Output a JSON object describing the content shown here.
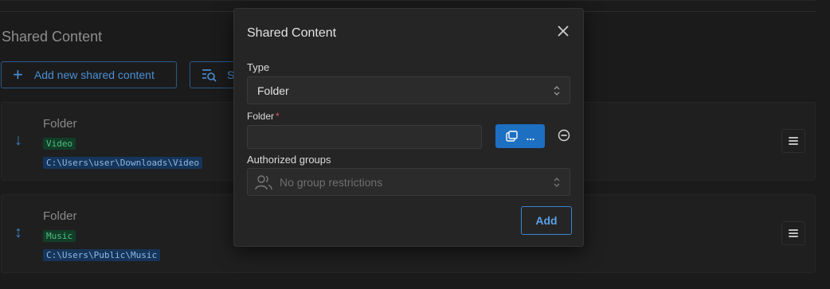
{
  "page": {
    "section_title": "Shared Content",
    "add_button_label": "Add new shared content",
    "search_button_label": "S"
  },
  "cards": [
    {
      "title": "Folder",
      "tag": "Video",
      "path": "C:\\Users\\user\\Downloads\\Video",
      "arrow": "↓"
    },
    {
      "title": "Folder",
      "tag": "Music",
      "path": "C:\\Users\\Public\\Music",
      "arrow": "↕"
    }
  ],
  "modal": {
    "title": "Shared Content",
    "type_label": "Type",
    "type_value": "Folder",
    "folder_label": "Folder",
    "required_marker": "*",
    "folder_value": "",
    "browse_label": "...",
    "groups_label": "Authorized groups",
    "groups_placeholder": "No group restrictions",
    "add_label": "Add"
  },
  "colors": {
    "accent": "#1d6fc2",
    "background": "#1b1b1b",
    "tag_green": "#4fbf82",
    "path_blue": "#8fb9e6",
    "required": "#e0555a"
  },
  "icons": [
    "plus-icon",
    "search-filter-icon",
    "arrow-down-icon",
    "arrow-updown-icon",
    "menu-icon",
    "close-icon",
    "chevron-updown-icon",
    "folder-browse-icon",
    "remove-circle-icon",
    "users-icon"
  ]
}
